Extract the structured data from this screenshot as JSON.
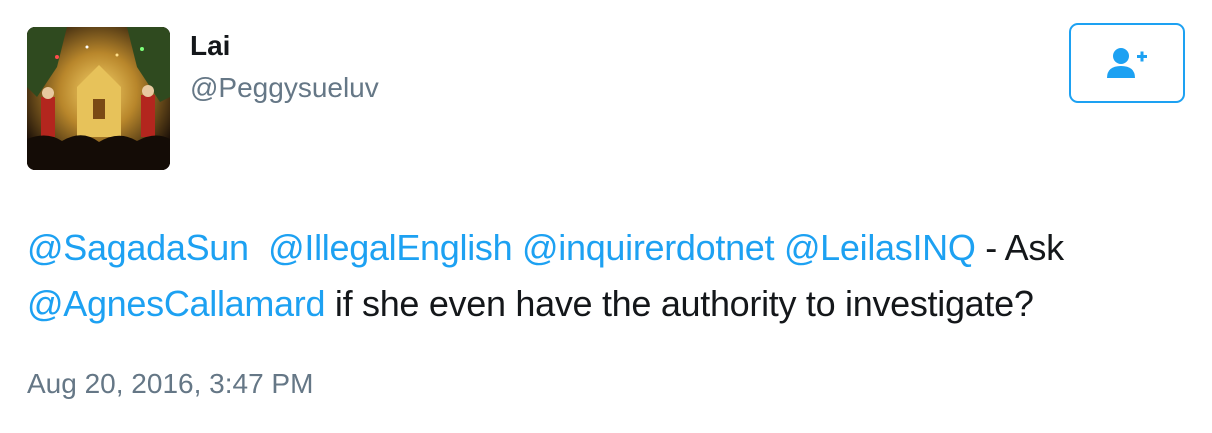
{
  "user": {
    "display_name": "Lai",
    "handle": "@Peggysueluv"
  },
  "follow_button": {
    "icon": "follow-user-icon",
    "color": "#1da1f2"
  },
  "tweet": {
    "mention_1": "@SagadaSun",
    "mention_2": "@IllegalEnglish",
    "mention_3": "@inquirerdotnet",
    "mention_4": "@LeilasINQ",
    "text_1": "- Ask",
    "mention_5": "@AgnesCallamard",
    "text_2": "if she even have the authority to investigate?",
    "timestamp": "Aug 20, 2016, 3:47 PM"
  },
  "colors": {
    "link": "#1da1f2",
    "secondary_text": "#657786",
    "primary_text": "#14171a"
  }
}
